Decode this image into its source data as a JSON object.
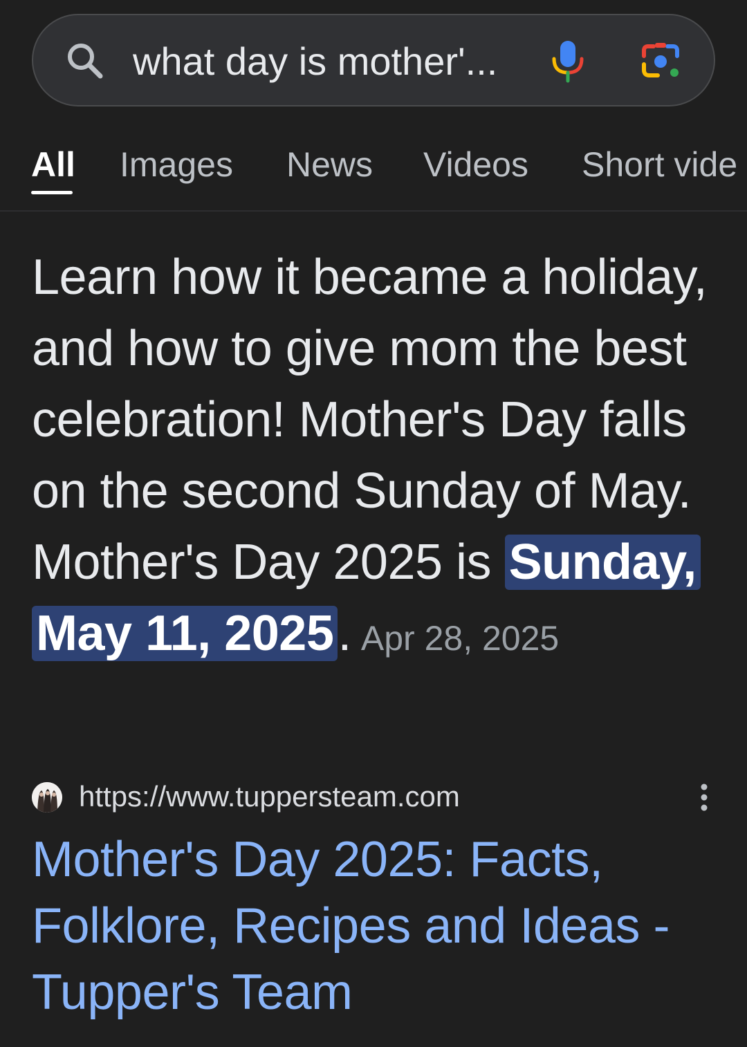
{
  "search": {
    "query": "what day is mother'..."
  },
  "tabs": [
    {
      "label": "All",
      "active": true
    },
    {
      "label": "Images",
      "active": false
    },
    {
      "label": "News",
      "active": false
    },
    {
      "label": "Videos",
      "active": false
    },
    {
      "label": "Short vide",
      "active": false
    }
  ],
  "snippet": {
    "text_before": "Learn how it became a holiday, and how to give mom the best celebration! Mother's Day falls on the second Sunday of May. Mother's Day 2025 is ",
    "highlight": "Sunday, May 11, 2025",
    "text_after": ".",
    "date": "Apr 28, 2025"
  },
  "result": {
    "url": "https://www.tuppersteam.com",
    "title": "Mother's Day 2025: Facts, Folklore, Recipes and Ideas - Tupper's Team"
  },
  "colors": {
    "background": "#1f1f1f",
    "link": "#8ab4f8",
    "highlight": "#2e4274"
  }
}
